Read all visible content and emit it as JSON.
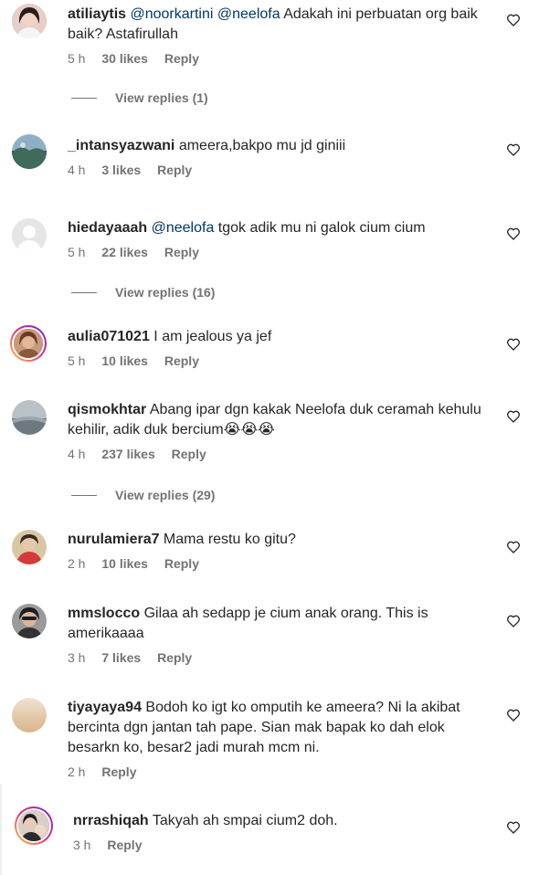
{
  "comments": [
    {
      "username": "atiliaytis",
      "mention1": "@noorkartini",
      "mention2": "@neelofa",
      "text": " Adakah ini perbuatan org baik baik? Astafirullah",
      "time": "5 h",
      "likes": "30 likes",
      "reply": "Reply",
      "view_replies": "View replies (1)"
    },
    {
      "username": "_intansyazwani",
      "text": " ameera,bakpo mu jd giniii",
      "time": "4 h",
      "likes": "3 likes",
      "reply": "Reply"
    },
    {
      "username": "hiedayaaah",
      "mention1": "@neelofa",
      "text": " tgok adik mu ni galok cium cium",
      "time": "5 h",
      "likes": "22 likes",
      "reply": "Reply",
      "view_replies": "View replies (16)"
    },
    {
      "username": "aulia071021",
      "text": " I am jealous ya jef",
      "time": "5 h",
      "likes": "10 likes",
      "reply": "Reply"
    },
    {
      "username": "qismokhtar",
      "text": " Abang ipar dgn kakak Neelofa duk ceramah kehulu kehilir, adik duk bercium😭😭😭",
      "time": "4 h",
      "likes": "237 likes",
      "reply": "Reply",
      "view_replies": "View replies (29)"
    },
    {
      "username": "nurulamiera7",
      "text": " Mama restu ko gitu?",
      "time": "2 h",
      "likes": "10 likes",
      "reply": "Reply"
    },
    {
      "username": "mmslocco",
      "text": " Gilaa ah sedapp je cium anak orang. This is amerikaaaa",
      "time": "3 h",
      "likes": "7 likes",
      "reply": "Reply"
    },
    {
      "username": "tiyayaya94",
      "text": " Bodoh ko igt ko omputih ke ameera? Ni la akibat bercinta dgn jantan tah pape. Sian mak bapak ko dah elok besarkn ko, besar2 jadi murah mcm ni.",
      "time": "2 h",
      "reply": "Reply"
    },
    {
      "username": "nrrashiqah",
      "text": " Takyah ah smpai cium2 doh.",
      "time": "3 h",
      "reply": "Reply"
    }
  ],
  "icons": {
    "like": "heart-outline-icon"
  },
  "colors": {
    "mention": "#00376b",
    "meta": "#737373",
    "text": "#262626"
  }
}
